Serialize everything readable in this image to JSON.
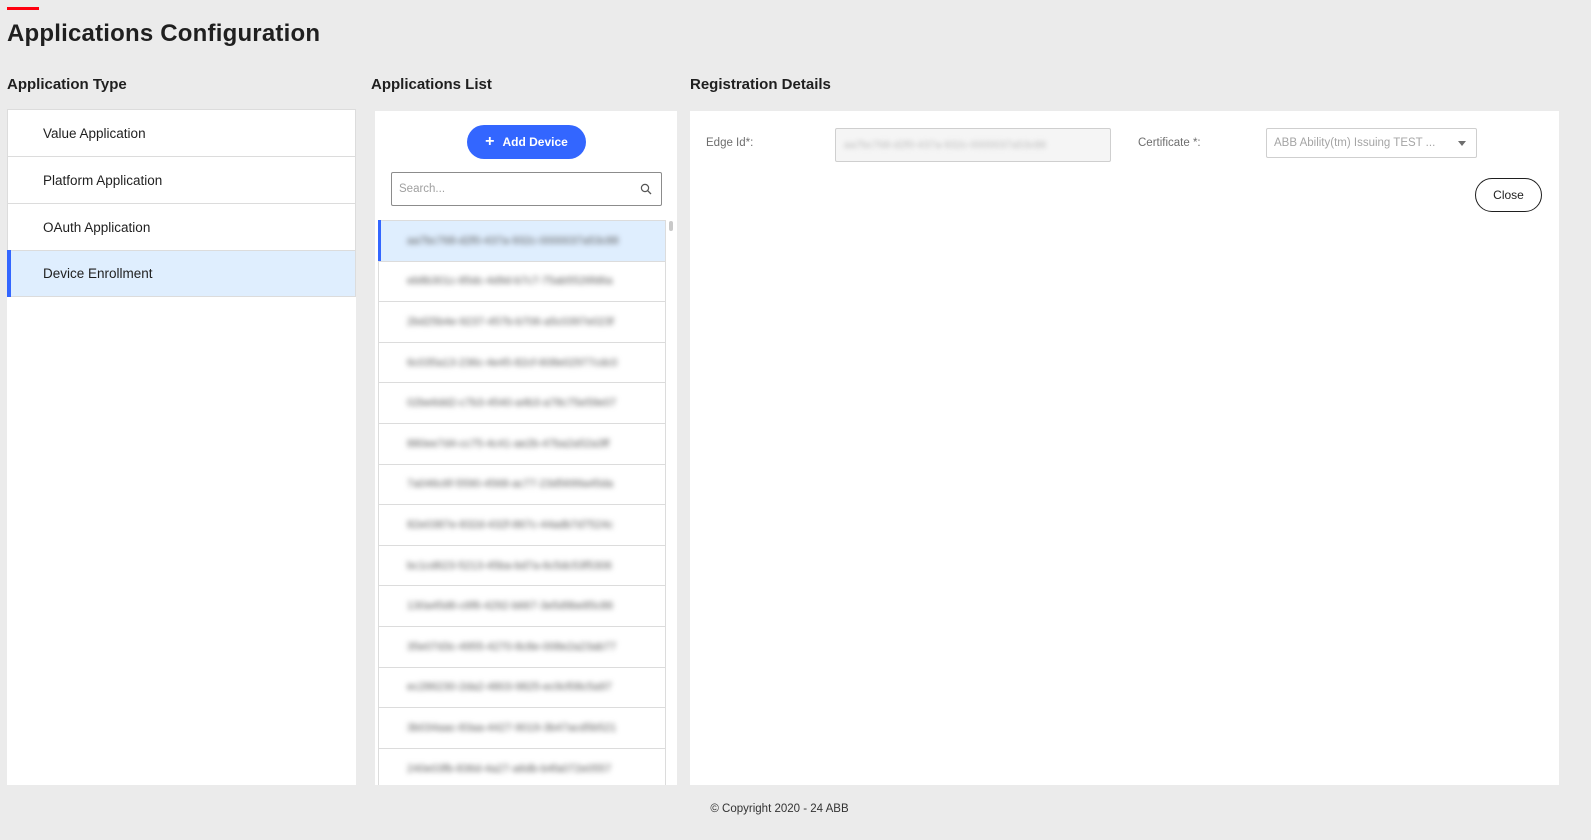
{
  "page": {
    "title": "Applications Configuration"
  },
  "sections": {
    "application_type": "Application Type",
    "applications_list": "Applications List",
    "registration_details": "Registration Details"
  },
  "application_types": [
    {
      "label": "Value Application",
      "active": false
    },
    {
      "label": "Platform Application",
      "active": false
    },
    {
      "label": "OAuth Application",
      "active": false
    },
    {
      "label": "Device Enrollment",
      "active": true
    }
  ],
  "applications_list": {
    "add_button_label": "Add Device",
    "add_button_icon": "plus-icon",
    "search_placeholder": "Search...",
    "search_icon": "search-icon",
    "devices": [
      "aa7bc768-d2f0-437a-932c-0000037a53c88",
      "eb8b301c-85dc-4d9d-b7c7-75ab5526fd6a",
      "2bd25b4e-9237-457b-b706-a5c0397e023f",
      "6c035a13-236c-4e45-82cf-608e02977cdc0",
      "02be6dd2-c7b3-4540-a4b3-a78c75e59e07",
      "880ee7d4-cc75-4c41-ae2b-47ba2a52a3ff",
      "7a046c6f-5590-4568-ac77-23d5699a45da",
      "82e0387e-832d-432f-867c-44adb7d7524c",
      "bc1cd623-5213-45ba-bd7a-6c5dc53f5306",
      "130a45d6-c6f6-4292-b667-3e5d9be85c86",
      "35e07d3c-4955-4270-8c8e-008e2a23ab77",
      "ec286230-2da2-4803-9825-ec9cf08c5a97",
      "3b034aac-83aa-4427-9019-3b47acd5b521",
      "240e03fb-836d-4a27-a6db-b4fa072e0557"
    ],
    "selected_index": 0
  },
  "registration": {
    "edge_id_label": "Edge Id*:",
    "edge_id_value": "aa7bc768-d2f0-437a-932c-0000037a53c88",
    "certificate_label": "Certificate *:",
    "certificate_value": "ABB Ability(tm) Issuing TEST ...",
    "close_label": "Close"
  },
  "footer": {
    "copyright": "© Copyright 2020 - 24 ABB"
  },
  "colors": {
    "accent_red": "#ff000f",
    "primary_blue": "#3366ff",
    "selected_bg": "#dfeefe",
    "page_bg": "#ebebeb"
  }
}
